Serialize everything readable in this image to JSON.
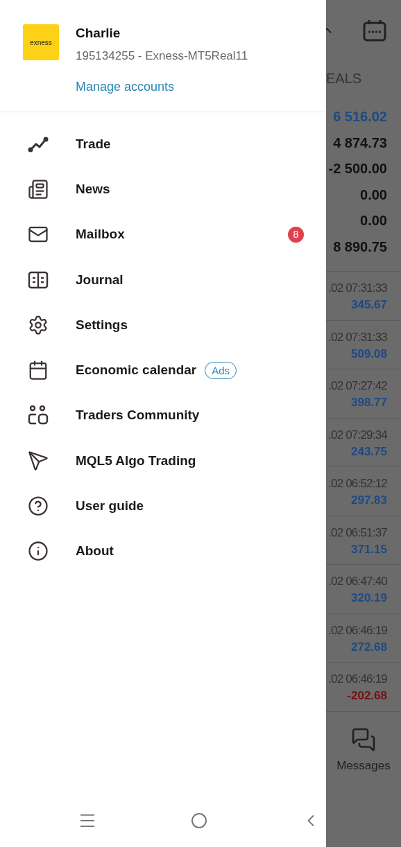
{
  "drawer": {
    "account": {
      "logo": "exness",
      "name": "Charlie",
      "login": "195134255 - Exness-MT5Real11",
      "manage_link": "Manage accounts"
    },
    "menu": [
      {
        "label": "Trade"
      },
      {
        "label": "News"
      },
      {
        "label": "Mailbox",
        "badge": "8"
      },
      {
        "label": "Journal"
      },
      {
        "label": "Settings"
      },
      {
        "label": "Economic calendar",
        "tag": "Ads"
      },
      {
        "label": "Traders Community"
      },
      {
        "label": "MQL5 Algo Trading"
      },
      {
        "label": "User guide"
      },
      {
        "label": "About"
      }
    ]
  },
  "background": {
    "tab_label": "EALS",
    "summary": [
      {
        "value": "6 516.02",
        "color": "#1d4a86"
      },
      {
        "value": "4 874.73",
        "color": "#111111"
      },
      {
        "value": "-2 500.00",
        "color": "#111111"
      },
      {
        "value": "0.00",
        "color": "#111111"
      },
      {
        "value": "0.00",
        "color": "#111111"
      },
      {
        "value": "8 890.75",
        "color": "#111111"
      }
    ],
    "deals": [
      {
        "time": ".02 07:31:33",
        "amount": "345.67",
        "color": "#1d4a86"
      },
      {
        "time": ".02 07:31:33",
        "amount": "509.08",
        "color": "#1d4a86"
      },
      {
        "time": ".02 07:27:42",
        "amount": "398.77",
        "color": "#1d4a86"
      },
      {
        "time": ".02 07:29:34",
        "amount": "243.75",
        "color": "#1d4a86"
      },
      {
        "time": ".02 06:52:12",
        "amount": "297.83",
        "color": "#1d4a86"
      },
      {
        "time": ".02 06:51:37",
        "amount": "371.15",
        "color": "#1d4a86"
      },
      {
        "time": ".02 06:47:40",
        "amount": "320.19",
        "color": "#1d4a86"
      },
      {
        "time": ".02 06:46:19",
        "amount": "272.68",
        "color": "#1d4a86"
      },
      {
        "time": ".02 06:46:19",
        "amount": "-202.68",
        "color": "#7a1010"
      }
    ],
    "messages_label": "Messages"
  }
}
